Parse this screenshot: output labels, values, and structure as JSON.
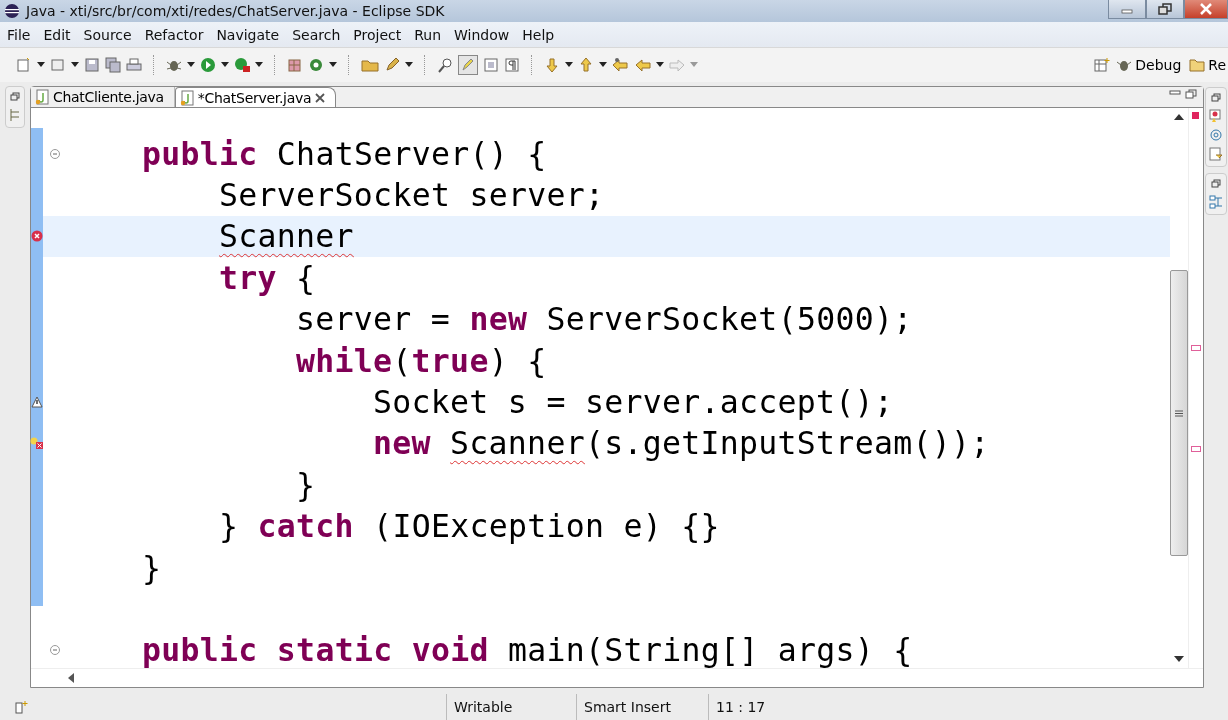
{
  "window": {
    "title": "Java - xti/src/br/com/xti/redes/ChatServer.java - Eclipse SDK"
  },
  "menu": [
    "File",
    "Edit",
    "Source",
    "Refactor",
    "Navigate",
    "Search",
    "Project",
    "Run",
    "Window",
    "Help"
  ],
  "perspectives": [
    {
      "label": "Debug",
      "selected": false
    },
    {
      "label": "Re",
      "selected": false
    }
  ],
  "tabs": [
    {
      "label": "ChatCliente.java",
      "selected": false,
      "closable": false
    },
    {
      "label": "*ChatServer.java",
      "selected": true,
      "closable": true
    }
  ],
  "code": [
    {
      "fold": true,
      "segments": [
        {
          "text": "public",
          "kind": "keyword"
        },
        {
          "text": " ChatServer() {"
        }
      ],
      "children": [
        {
          "segments": [
            {
              "text": "ServerSocket server;"
            }
          ]
        },
        {
          "current": true,
          "has_error": true,
          "segments": [
            {
              "text": "Scanner",
              "kind": "error"
            }
          ]
        },
        {
          "segments": [
            {
              "text": "try",
              "kind": "keyword"
            },
            {
              "text": " {"
            }
          ],
          "children": [
            {
              "segments": [
                {
                  "text": "server = "
                },
                {
                  "text": "new",
                  "kind": "keyword"
                },
                {
                  "text": " ServerSocket(5000);"
                }
              ]
            },
            {
              "segments": [
                {
                  "text": "while",
                  "kind": "keyword"
                },
                {
                  "text": "("
                },
                {
                  "text": "true",
                  "kind": "keyword"
                },
                {
                  "text": ") {"
                }
              ],
              "children": [
                {
                  "has_warning": true,
                  "segments": [
                    {
                      "text": "Socket s = server.accept();"
                    }
                  ]
                },
                {
                  "has_quickfix": true,
                  "segments": [
                    {
                      "text": "new ",
                      "kind": "keyword"
                    },
                    {
                      "text": "Scanner",
                      "kind": "error"
                    },
                    {
                      "text": "(s.getInputStream());"
                    }
                  ]
                }
              ]
            },
            {
              "segments": [
                {
                  "text": "}"
                }
              ]
            }
          ]
        },
        {
          "segments": [
            {
              "text": "} "
            },
            {
              "text": "catch",
              "kind": "keyword"
            },
            {
              "text": " (IOException e) {}"
            }
          ]
        }
      ]
    },
    {
      "segments": [
        {
          "text": "}"
        }
      ]
    },
    {
      "fold": true,
      "segments": [
        {
          "text": "public static void",
          "kind": "keyword"
        },
        {
          "text": " main(String[] args) {"
        }
      ]
    }
  ],
  "status_bar": {
    "mode": "Writable",
    "insert": "Smart Insert",
    "position": "11 : 17"
  }
}
